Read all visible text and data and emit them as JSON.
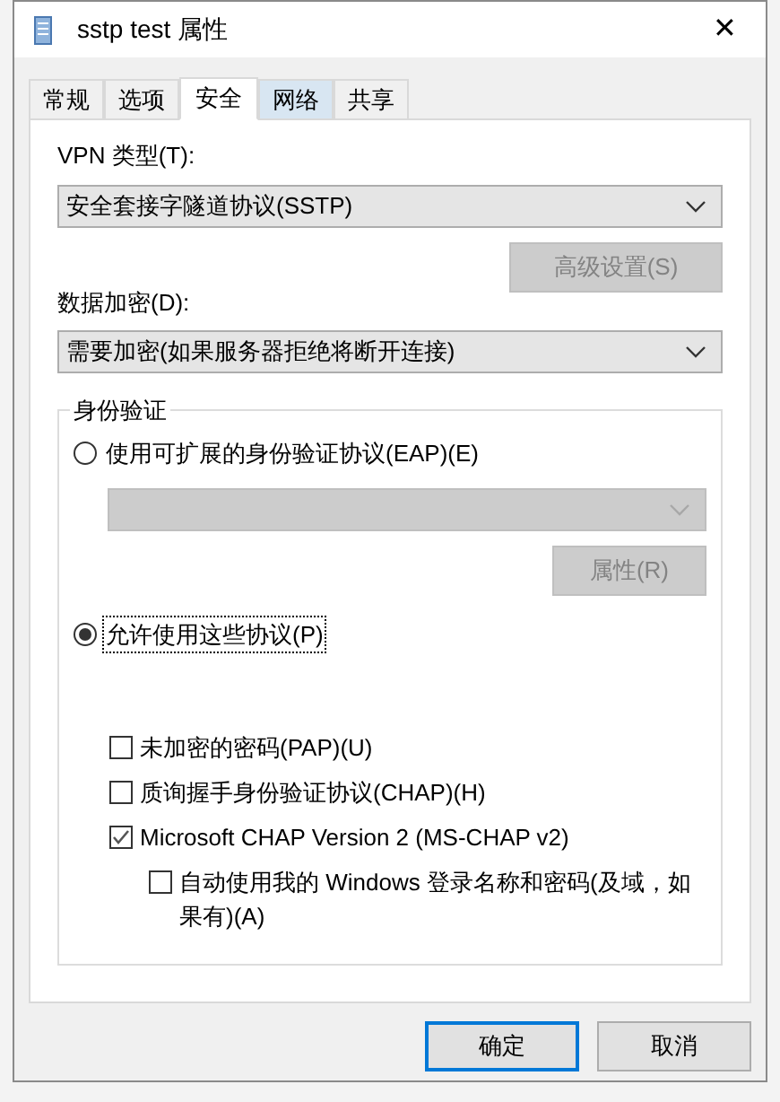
{
  "window": {
    "title": "sstp test 属性",
    "close": "✕"
  },
  "tabs": [
    {
      "label": "常规",
      "selected": false,
      "hover": false
    },
    {
      "label": "选项",
      "selected": false,
      "hover": false
    },
    {
      "label": "安全",
      "selected": true,
      "hover": false
    },
    {
      "label": "网络",
      "selected": false,
      "hover": true
    },
    {
      "label": "共享",
      "selected": false,
      "hover": false
    }
  ],
  "vpn_type": {
    "label": "VPN 类型(T):",
    "value": "安全套接字隧道协议(SSTP)"
  },
  "advanced_button": {
    "label": "高级设置(S)",
    "disabled": true
  },
  "encryption": {
    "label": "数据加密(D):",
    "value": "需要加密(如果服务器拒绝将断开连接)"
  },
  "authentication": {
    "title": "身份验证",
    "eap": {
      "label": "使用可扩展的身份验证协议(EAP)(E)",
      "selected": false,
      "disabled": true,
      "properties_button": "属性(R)"
    },
    "protocols": {
      "label": "允许使用这些协议(P)",
      "selected": true,
      "focused": true
    },
    "options": [
      {
        "label": "未加密的密码(PAP)(U)",
        "checked": false,
        "indent": false
      },
      {
        "label": "质询握手身份验证协议(CHAP)(H)",
        "checked": false,
        "indent": false
      },
      {
        "label": "Microsoft CHAP Version 2 (MS-CHAP v2)",
        "checked": true,
        "indent": false
      },
      {
        "label": "自动使用我的 Windows 登录名称和密码(及域，如果有)(A)",
        "checked": false,
        "indent": true
      }
    ]
  },
  "buttons": [
    {
      "label": "确定",
      "default": true
    },
    {
      "label": "取消",
      "default": false
    }
  ]
}
